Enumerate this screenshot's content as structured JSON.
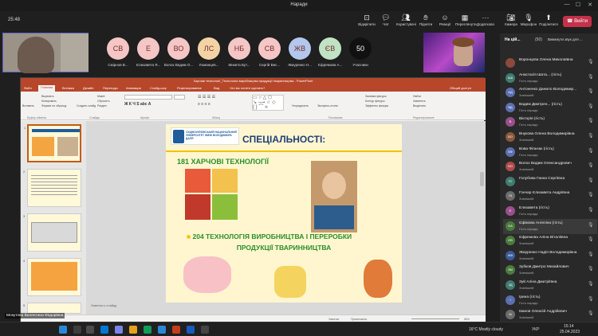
{
  "window": {
    "title": "Наради"
  },
  "toolbar": {
    "timer": "25:48",
    "buttons": [
      {
        "label": "Відкріпити",
        "icon": "unpin-icon"
      },
      {
        "label": "Чат",
        "icon": "chat-icon"
      },
      {
        "label": "Користувачі",
        "icon": "people-icon"
      },
      {
        "label": "Підняти",
        "icon": "raise-hand-icon"
      },
      {
        "label": "Реакції",
        "icon": "reactions-icon"
      },
      {
        "label": "Переглянути",
        "icon": "view-icon"
      },
      {
        "label": "Додатково",
        "icon": "more-icon"
      },
      {
        "label": "Камера",
        "icon": "camera-icon"
      },
      {
        "label": "Мікрофон",
        "icon": "mic-icon"
      },
      {
        "label": "Поділитися",
        "icon": "share-icon"
      }
    ],
    "leave_label": "Вийти"
  },
  "participants_row": [
    {
      "initials": "СВ",
      "name": "Смірнов В...",
      "color": "#f4c6c6"
    },
    {
      "initials": "Е",
      "name": "Єлизавета Я...",
      "color": "#f4c6c6"
    },
    {
      "initials": "ВО",
      "name": "Волох Вадим О...",
      "color": "#f4c6c6"
    },
    {
      "initials": "ЛС",
      "name": "Ломанцев...",
      "color": "#f3d3a5"
    },
    {
      "initials": "НБ",
      "name": "Микита Бут...",
      "color": "#f4c6c6"
    },
    {
      "initials": "СВ",
      "name": "Сергій Вис...",
      "color": "#f4c6c6"
    },
    {
      "initials": "ЖВ",
      "name": "Жмуренко Н...",
      "color": "#b3c7ec"
    },
    {
      "initials": "ЄВ",
      "name": "Єфремова А...",
      "color": "#bfe3c4"
    },
    {
      "initials": "50",
      "name": "Учасники",
      "color": "#111111"
    }
  ],
  "powerpoint": {
    "title": "Харчові технології_Технологія виробництва продукції тваринництва - PowerPoint",
    "tabs": [
      "Файл",
      "Главная",
      "Вставка",
      "Дизайн",
      "Переходы",
      "Анимация",
      "Слайд-шоу",
      "Рецензирование",
      "Вид",
      "Что вы хотите сделать?",
      "Общий доступ"
    ],
    "ribbon_groups": [
      "Буфер обмена",
      "Слайды",
      "Шрифт",
      "Абзац",
      "Рисование",
      "Редактирование"
    ],
    "ribbon_items": [
      "Вырезать",
      "Копировать",
      "Формат по образцу",
      "Вставить",
      "Создать слайд",
      "Макет",
      "Сбросить",
      "Раздел",
      "Упорядочить",
      "Экспресс-стили",
      "Заливка фигуры",
      "Контур фигуры",
      "Эффекты фигуры",
      "Найти",
      "Заменить",
      "Выделить"
    ],
    "notes_placeholder": "Заметки к слайду",
    "status": [
      "Заметки",
      "Примечания",
      "86%"
    ]
  },
  "slide": {
    "university": "СХІДНОУКРАЇНСЬКИЙ НАЦІОНАЛЬНИЙ УНІВЕРСИТЕТ ІМЕНІ ВОЛОДИМИРА ДАЛЯ",
    "heading": "СПЕЦІАЛЬНОСТІ:",
    "spec1": "181 ХАРЧОВІ ТЕХНОЛОГІЇ",
    "spec2_line1": "204 ТЕХНОЛОГІЯ ВИРОБНИЦТВА І ПЕРЕРОБКИ",
    "spec2_line2": "ПРОДУКЦІЇ ТВАРИННИЦТВА"
  },
  "panel": {
    "header": "На цій...",
    "count": "(50)",
    "mute_all": "Вимкнути звук для ...",
    "people": [
      {
        "initials": "",
        "name": "Воронцова Олена Миколаївна",
        "role": "",
        "color": "#8b4a3b"
      },
      {
        "initials": "АШ",
        "name": "Анастасія Шата... (гість)",
        "role": "Гість наради",
        "color": "#3f7c6f"
      },
      {
        "initials": "АД",
        "name": "Антоненко Данило Володимир...",
        "role": "Зовнішній",
        "color": "#5b6fb0"
      },
      {
        "initials": "ВД",
        "name": "Вадим Дмитрен... (гість)",
        "role": "Гість наради",
        "color": "#5b6fb0"
      },
      {
        "initials": "В",
        "name": "Вікторія (гість)",
        "role": "Гість наради",
        "color": "#9a4f8c"
      },
      {
        "initials": "ВО",
        "name": "Внукова Олена Володимирівна",
        "role": "Зовнішній",
        "color": "#8b5a3b"
      },
      {
        "initials": "ВФ",
        "name": "Вова Фільчак (гість)",
        "role": "Гість наради",
        "color": "#5b6fb0"
      },
      {
        "initials": "ВО",
        "name": "Волох Вадим Олександрович",
        "role": "Зовнішній",
        "color": "#b04a4a"
      },
      {
        "initials": "ГС",
        "name": "Голубова Ганна Сергіївна",
        "role": "",
        "color": "#3f7c6f"
      },
      {
        "initials": "ГА",
        "name": "Гончар Єлизавета Андріївна",
        "role": "Зовнішній",
        "color": "#6b6b6b"
      },
      {
        "initials": "Е",
        "name": "Елизавета (гість)",
        "role": "Гість наради",
        "color": "#9a4f8c"
      },
      {
        "initials": "ЄА",
        "name": "Єфімова Ангеліна (гість)",
        "role": "Гість наради",
        "color": "#4a7c3b"
      },
      {
        "initials": "ЄВ",
        "name": "Єфремова Аліна Віталіївна",
        "role": "Зовнішній",
        "color": "#4a7c3b"
      },
      {
        "initials": "ЖВ",
        "name": "Жмуренко Надія Володимирівна",
        "role": "Зовнішній",
        "color": "#3b5b9a"
      },
      {
        "initials": "ЗМ",
        "name": "Зубков Дмитро Михайлович",
        "role": "Зовнішній",
        "color": "#4a7c3b"
      },
      {
        "initials": "ЗД",
        "name": "Зуй Аліна Дмитріївна",
        "role": "Зовнішній",
        "color": "#3f7c6f"
      },
      {
        "initials": "І",
        "name": "Ірина (гість)",
        "role": "Гість наради",
        "color": "#5b6fb0"
      },
      {
        "initials": "ІА",
        "name": "Іванов Олексій Андрійович",
        "role": "Зовнішній",
        "color": "#6b6b6b"
      }
    ]
  },
  "caption": "Мокутова Валентина Федорівна",
  "taskbar": {
    "weather": "16°C  Mostly cloudy",
    "lang": "УКР",
    "time": "15:14",
    "date": "25.04.2023"
  }
}
